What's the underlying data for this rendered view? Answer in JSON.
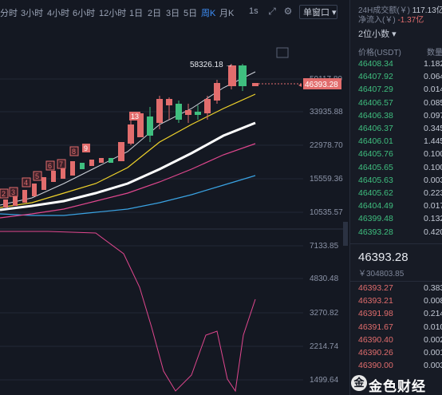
{
  "toolbar": {
    "timeframes": [
      "分时",
      "3小时",
      "4小时",
      "6小时",
      "12小时",
      "1日",
      "2日",
      "3日",
      "5日",
      "周K",
      "月K",
      "1s"
    ],
    "active_timeframe": "周K",
    "window_button": "单窗口"
  },
  "chart": {
    "high_label": "58326.18",
    "current_price": "46393.28",
    "candle_labels": [
      "2",
      "3",
      "4",
      "5",
      "6",
      "7",
      "8",
      "9",
      "13"
    ],
    "main_axis": [
      "50117.80",
      "33935.88",
      "22978.70",
      "15559.36",
      "10535.57"
    ],
    "sub_axis": [
      "7133.85",
      "4830.48",
      "3270.82",
      "2214.74",
      "1499.64"
    ],
    "colors": {
      "up": "#e26d6d",
      "down": "#3fbf7f",
      "ma_white": "#ffffff",
      "ma_yellow": "#f0d32b",
      "ma_pink": "#e0478e",
      "ma_blue": "#3aa3e3"
    }
  },
  "right_panel": {
    "volume_label": "24H成交额(￥)",
    "volume_value": "117.13亿",
    "inflow_label": "净流入(￥)",
    "inflow_value": "-1.37亿",
    "precision": "2位小数",
    "col_price": "价格(USDT)",
    "col_amount": "数量",
    "asks": [
      {
        "price": "46408.34",
        "amount": "1.182"
      },
      {
        "price": "46407.92",
        "amount": "0.064"
      },
      {
        "price": "46407.29",
        "amount": "0.014"
      },
      {
        "price": "46406.57",
        "amount": "0.085"
      },
      {
        "price": "46406.38",
        "amount": "0.097"
      },
      {
        "price": "46406.37",
        "amount": "0.345"
      },
      {
        "price": "46406.01",
        "amount": "1.445"
      },
      {
        "price": "46405.76",
        "amount": "0.100"
      },
      {
        "price": "46405.65",
        "amount": "0.100"
      },
      {
        "price": "46405.63",
        "amount": "0.003"
      },
      {
        "price": "46405.62",
        "amount": "0.223"
      },
      {
        "price": "46404.49",
        "amount": "0.017"
      },
      {
        "price": "46399.48",
        "amount": "0.132"
      },
      {
        "price": "46393.28",
        "amount": "0.420"
      }
    ],
    "mid_price": "46393.28",
    "mid_cny": "￥304803.85",
    "bids": [
      {
        "price": "46393.27",
        "amount": "0.383"
      },
      {
        "price": "46393.21",
        "amount": "0.008"
      },
      {
        "price": "46391.98",
        "amount": "0.214"
      },
      {
        "price": "46391.67",
        "amount": "0.010"
      },
      {
        "price": "46390.40",
        "amount": "0.002"
      },
      {
        "price": "46390.26",
        "amount": "0.001"
      },
      {
        "price": "46390.00",
        "amount": "0.003"
      }
    ]
  },
  "watermark": "金色财经"
}
